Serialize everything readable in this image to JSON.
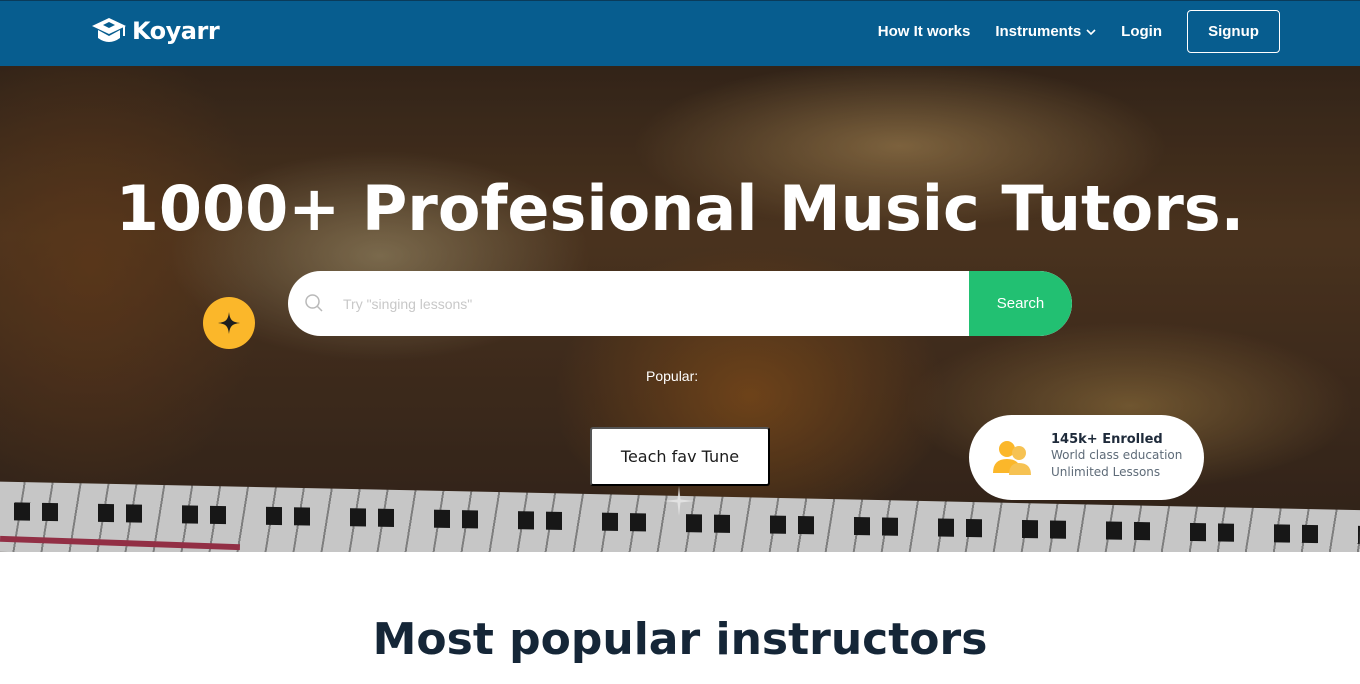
{
  "brand": {
    "name": "Koyarr",
    "logo_icon": "graduation-cap-icon"
  },
  "nav": {
    "items": [
      {
        "label": "How It works"
      },
      {
        "label": "Instruments",
        "dropdown": true
      }
    ],
    "login_label": "Login",
    "signup_label": "Signup"
  },
  "hero": {
    "title": "1000+ Profesional Music Tutors.",
    "search": {
      "placeholder": "Try \"singing lessons\"",
      "button_label": "Search"
    },
    "popular_label": "Popular:",
    "popular_tag": "Teach fav Tune",
    "stat_card": {
      "title": "145k+ Enrolled",
      "line1": "World class education",
      "line2": "Unlimited Lessons",
      "icon": "users-icon"
    }
  },
  "section": {
    "title": "Most popular instructors"
  },
  "colors": {
    "nav_bg": "#075d8f",
    "search_button": "#22c072",
    "badge_yellow": "#fbb72a",
    "heading_dark": "#152637"
  }
}
